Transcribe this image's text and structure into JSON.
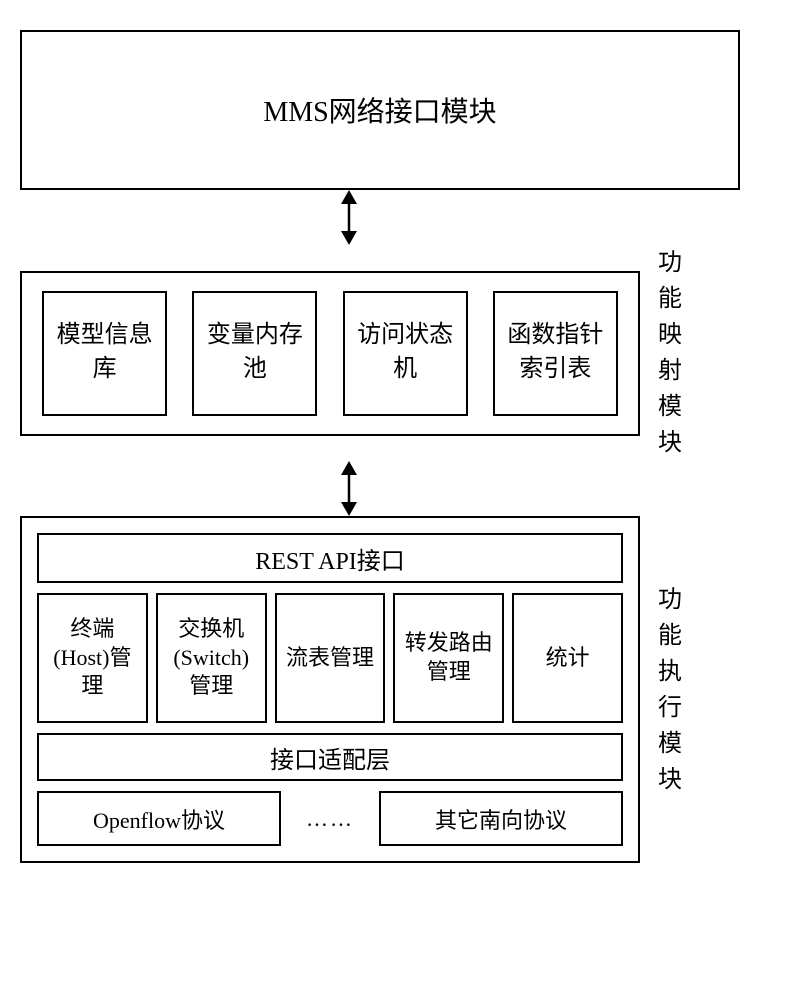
{
  "topModule": {
    "title": "MMS网络接口模块"
  },
  "mappingModule": {
    "label": "功能映射模块",
    "items": [
      "模型信息库",
      "变量内存池",
      "访问状态机",
      "函数指针索引表"
    ]
  },
  "execModule": {
    "label": "功能执行模块",
    "restApi": "REST API接口",
    "mgmtItems": [
      "终端(Host)管理",
      "交换机(Switch)管理",
      "流表管理",
      "转发路由管理",
      "统计"
    ],
    "adapterLayer": "接口适配层",
    "protocols": {
      "left": "Openflow协议",
      "dots": "……",
      "right": "其它南向协议"
    }
  }
}
